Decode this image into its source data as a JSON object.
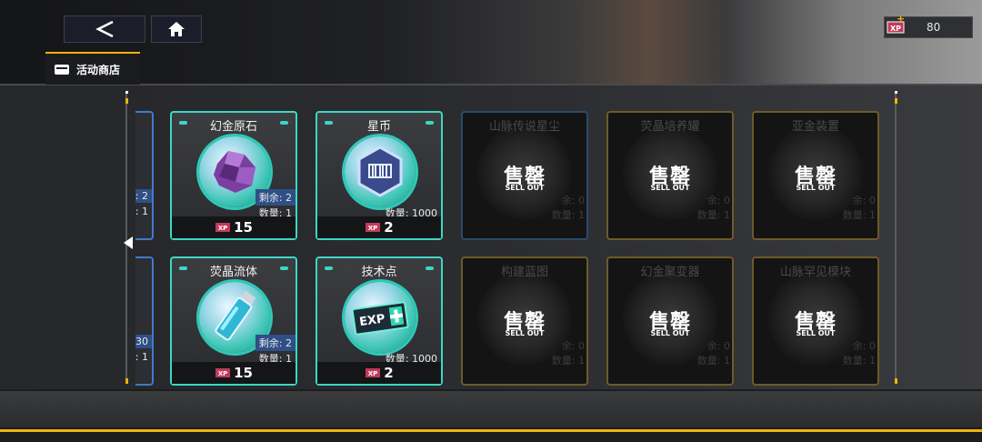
{
  "shop_tab": {
    "label": "活动商店"
  },
  "currency": {
    "amount": "80",
    "icon": "xp-ticket-icon"
  },
  "sold_text": {
    "cn": "售罄",
    "en": "SELL OUT"
  },
  "labels": {
    "remain_prefix": "剩余: ",
    "qty_prefix": "数量: "
  },
  "partial_cards": [
    {
      "remain": ": 2",
      "qty": ": 1"
    },
    {
      "remain": "30",
      "qty": ": 1"
    }
  ],
  "items": [
    {
      "name": "幻金原石",
      "remain": "剩余: 2",
      "qty": "数量: 1",
      "price": "15",
      "status": "available"
    },
    {
      "name": "星币",
      "remain": "",
      "qty": "数量: 1000",
      "price": "2",
      "status": "available"
    },
    {
      "name": "山脉传说星尘",
      "remain": "余: 0",
      "qty": "数量: 1",
      "status": "sold"
    },
    {
      "name": "荧晶培养罐",
      "remain": "余: 0",
      "qty": "数量: 1",
      "status": "sold"
    },
    {
      "name": "亚金装置",
      "remain": "余: 0",
      "qty": "数量: 1",
      "status": "sold"
    },
    {
      "name": "荧晶流体",
      "remain": "剩余: 2",
      "qty": "数量: 1",
      "price": "15",
      "status": "available"
    },
    {
      "name": "技术点",
      "remain": "",
      "qty": "数量: 1000",
      "price": "2",
      "status": "available"
    },
    {
      "name": "构建蓝图",
      "remain": "余: 0",
      "qty": "数量: 1",
      "status": "sold"
    },
    {
      "name": "幻金聚变器",
      "remain": "余: 0",
      "qty": "数量: 1",
      "status": "sold"
    },
    {
      "name": "山脉罕见模块",
      "remain": "余: 0",
      "qty": "数量: 1",
      "status": "sold"
    }
  ],
  "colors": {
    "accent": "#f0b20a",
    "teal": "#3ad8c4",
    "sold_border": "#6e5a2a"
  }
}
